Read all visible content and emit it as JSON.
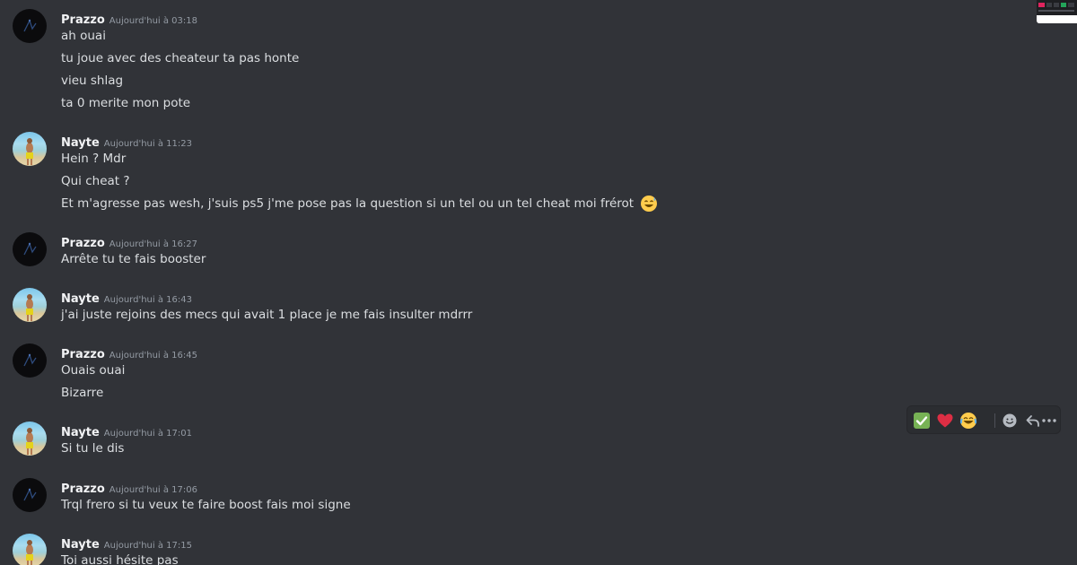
{
  "messages": [
    {
      "author": "Prazzo",
      "timestamp": "Aujourd'hui à 03:18",
      "avatar": "prazzo",
      "lines": [
        "ah ouai",
        "tu joue avec des cheateur ta pas honte",
        "vieu shlag",
        "ta 0 merite mon pote"
      ]
    },
    {
      "author": "Nayte",
      "timestamp": "Aujourd'hui à 11:23",
      "avatar": "nayte",
      "lines": [
        "Hein ? Mdr",
        "Qui cheat ?",
        "Et m'agresse pas wesh, j'suis ps5 j'me pose pas la question si un tel ou un tel cheat moi frérot"
      ]
    },
    {
      "author": "Prazzo",
      "timestamp": "Aujourd'hui à 16:27",
      "avatar": "prazzo",
      "lines": [
        "Arrête tu te fais booster"
      ]
    },
    {
      "author": "Nayte",
      "timestamp": "Aujourd'hui à 16:43",
      "avatar": "nayte",
      "lines": [
        "j'ai juste rejoins des mecs qui avait 1 place je me fais insulter mdrrr"
      ]
    },
    {
      "author": "Prazzo",
      "timestamp": "Aujourd'hui à 16:45",
      "avatar": "prazzo",
      "lines": [
        "Ouais ouai",
        "Bizarre"
      ]
    },
    {
      "author": "Nayte",
      "timestamp": "Aujourd'hui à 17:01",
      "avatar": "nayte",
      "lines": [
        "Si tu le dis"
      ]
    },
    {
      "author": "Prazzo",
      "timestamp": "Aujourd'hui à 17:06",
      "avatar": "prazzo",
      "lines": [
        "Trql frero si tu veux te faire boost fais moi signe"
      ]
    },
    {
      "author": "Nayte",
      "timestamp": "Aujourd'hui à 17:15",
      "avatar": "nayte",
      "lines": [
        "Toi aussi hésite pas"
      ]
    }
  ],
  "inline_emoji": "sweat-smile-emoji",
  "hover_toolbar": {
    "reactions": [
      "white-check-mark-emoji",
      "red-heart-emoji",
      "joy-emoji"
    ],
    "actions": [
      "add-reaction-icon",
      "reply-icon",
      "more-icon"
    ]
  },
  "colors": {
    "background": "#313338",
    "author": "#f2f3f5",
    "timestamp": "#949ba4",
    "text": "#dbdee1",
    "toolbar_bg": "#2b2d31"
  }
}
